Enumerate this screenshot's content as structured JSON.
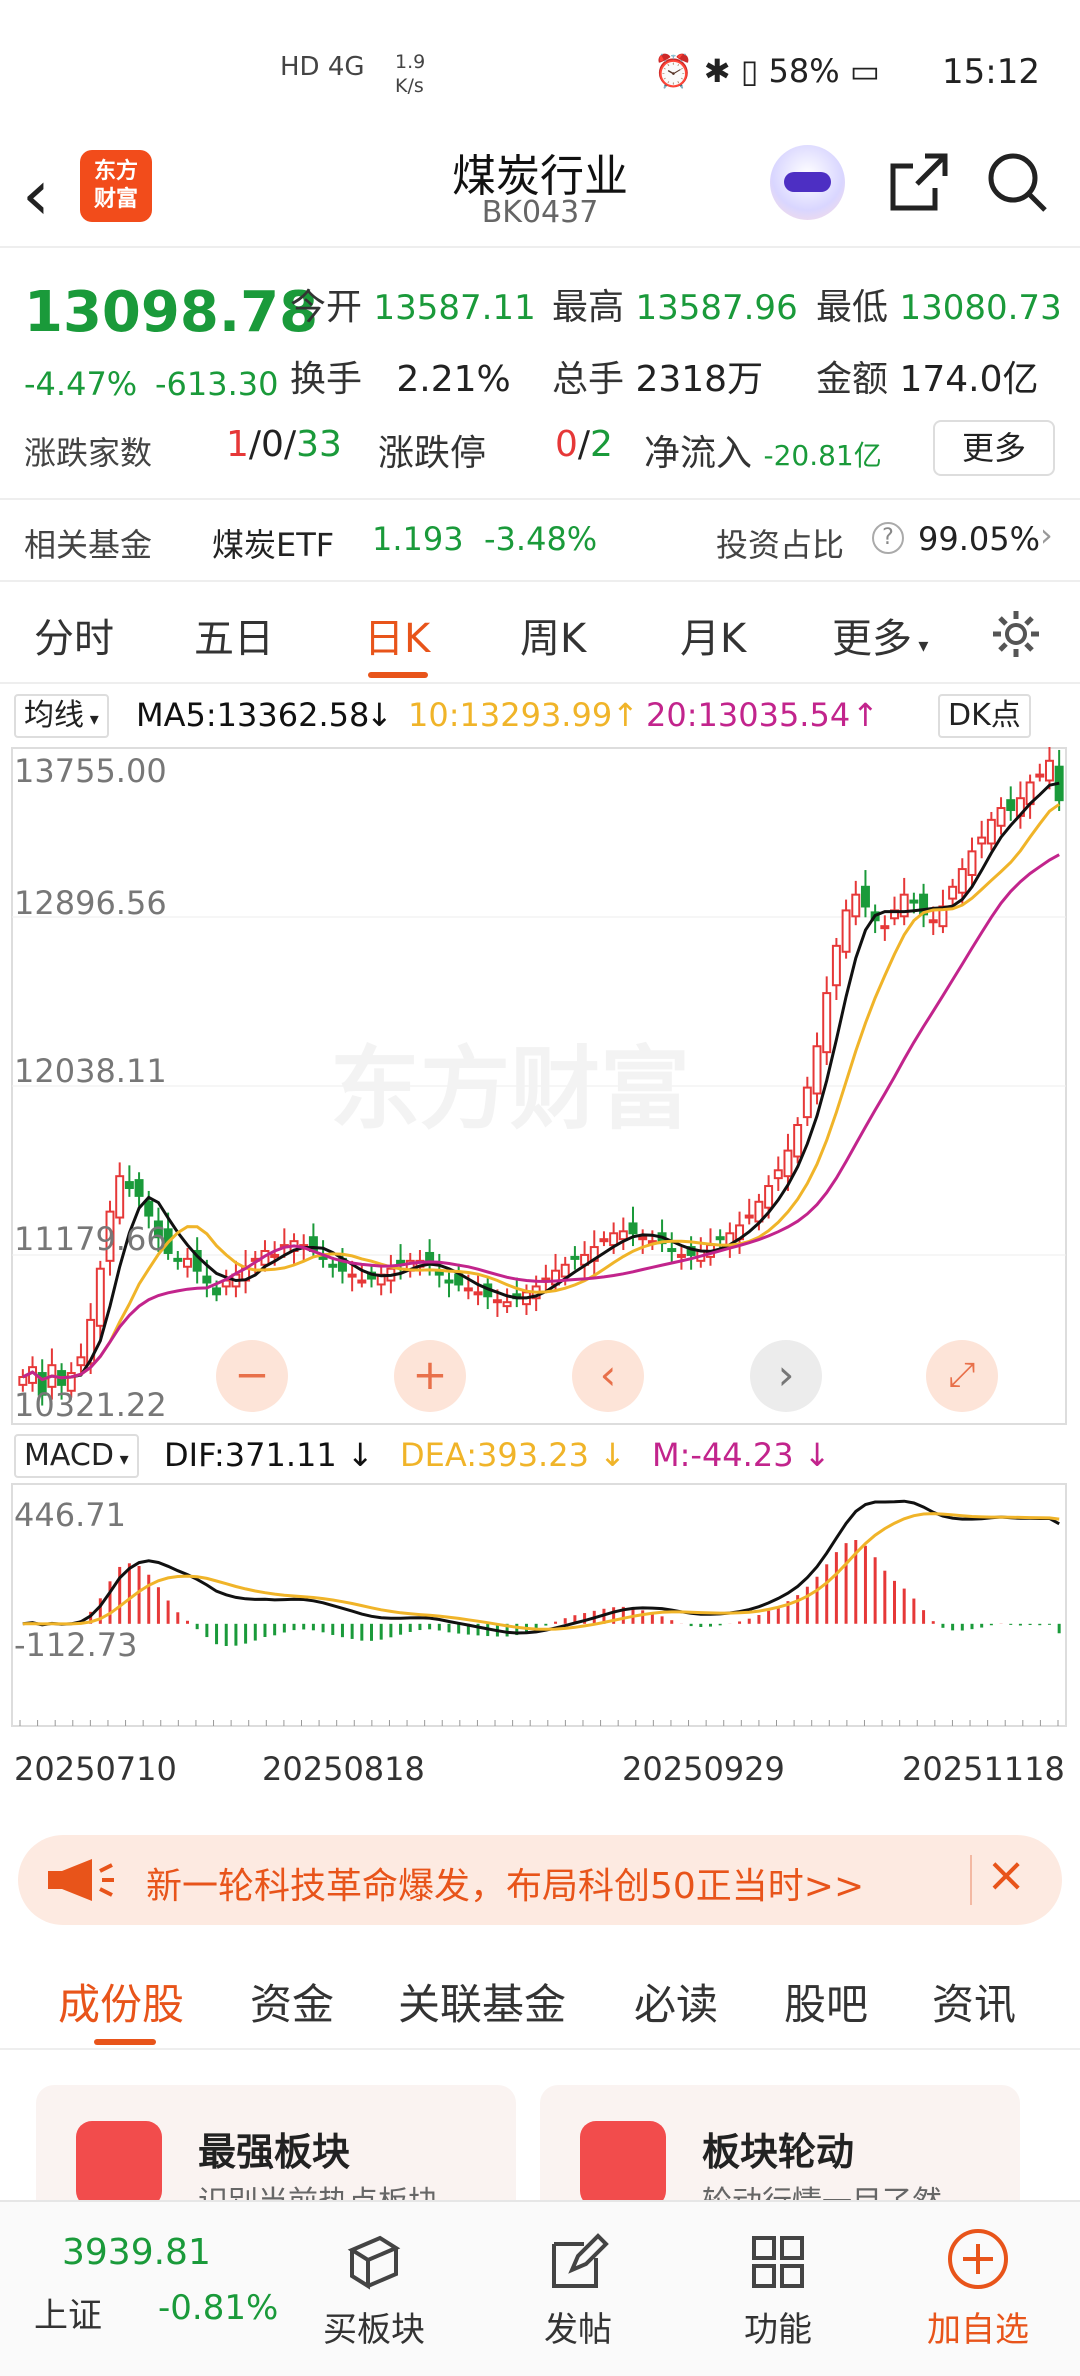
{
  "status": {
    "net": "HD 4G",
    "speed_value": "1.9",
    "speed_unit": "K/s",
    "battery": "58%",
    "time": "15:12"
  },
  "header": {
    "title": "煤炭行业",
    "code": "BK0437",
    "logo_text": "东方财富"
  },
  "quote": {
    "price": "13098.78",
    "change_pct": "-4.47%",
    "change": "-613.30",
    "open_label": "今开",
    "open": "13587.11",
    "high_label": "最高",
    "high": "13587.96",
    "low_label": "最低",
    "low": "13080.73",
    "turnover_label": "换手",
    "turnover": "2.21%",
    "volume_label": "总手",
    "volume": "2318万",
    "amount_label": "金额",
    "amount": "174.0亿",
    "breadth_label": "涨跌家数",
    "up": "1",
    "flat": "0",
    "down": "33",
    "limit_label": "涨跌停",
    "limit_up": "0",
    "limit_down": "2",
    "inflow_label": "净流入",
    "inflow": "-20.81亿",
    "more": "更多"
  },
  "fund": {
    "label": "相关基金",
    "name": "煤炭ETF",
    "price": "1.193",
    "pct": "-3.48%",
    "ratio_label": "投资占比",
    "ratio": "99.05%"
  },
  "chart_tabs": [
    "分时",
    "五日",
    "日K",
    "周K",
    "月K",
    "更多"
  ],
  "ma_legend": {
    "selector": "均线",
    "ma5": "MA5:13362.58",
    "ma10": "10:13293.99",
    "ma20": "20:13035.54",
    "dk": "DK点"
  },
  "macd_legend": {
    "selector": "MACD",
    "dif": "DIF:371.11",
    "dea": "DEA:393.23",
    "m": "M:-44.23"
  },
  "watermark": "东方财富",
  "chart_data": {
    "type": "candlestick",
    "price_axis": [
      "13755.00",
      "12896.56",
      "12038.11",
      "11179.66",
      "10321.22"
    ],
    "macd_axis": [
      "446.71",
      "-112.73"
    ],
    "dates": [
      "20250710",
      "20250818",
      "20250929",
      "20251118"
    ],
    "colors": {
      "up": "#e63838",
      "down": "#1a9a3a",
      "ma5": "#111111",
      "ma10": "#f0b429",
      "ma20": "#c2248c"
    },
    "close": [
      10560,
      10610,
      10470,
      10620,
      10520,
      10580,
      10660,
      10850,
      11110,
      11400,
      11580,
      11520,
      11480,
      11380,
      11270,
      11190,
      11150,
      11160,
      11100,
      11040,
      10980,
      11050,
      11080,
      11120,
      11160,
      11200,
      11180,
      11230,
      11250,
      11230,
      11200,
      11160,
      11120,
      11100,
      11080,
      11050,
      11060,
      11080,
      11110,
      11130,
      11150,
      11150,
      11130,
      11080,
      11040,
      11030,
      11010,
      10990,
      10970,
      10950,
      10940,
      10960,
      10990,
      11020,
      11060,
      11100,
      11130,
      11160,
      11180,
      11220,
      11260,
      11290,
      11300,
      11290,
      11270,
      11250,
      11240,
      11200,
      11180,
      11180,
      11200,
      11230,
      11260,
      11290,
      11330,
      11380,
      11450,
      11530,
      11610,
      11710,
      11840,
      12030,
      12240,
      12510,
      12750,
      12930,
      13010,
      12950,
      12880,
      12850,
      12930,
      13010,
      12970,
      12910,
      12880,
      12950,
      13050,
      13140,
      13230,
      13300,
      13390,
      13450,
      13440,
      13500,
      13580,
      13620,
      13690,
      13490
    ]
  },
  "promo": {
    "text": "新一轮科技革命爆发，布局科创50正当时>>"
  },
  "detail_tabs": [
    "成份股",
    "资金",
    "关联基金",
    "必读",
    "股吧",
    "资讯"
  ],
  "cards": [
    {
      "title": "最强板块",
      "sub": "识别当前热点板块"
    },
    {
      "title": "板块轮动",
      "sub": "轮动行情一目了然"
    }
  ],
  "bottom": {
    "index_value": "3939.81",
    "index_name": "上证",
    "index_pct": "-0.81%",
    "items": [
      "买板块",
      "发帖",
      "功能",
      "加自选"
    ]
  }
}
